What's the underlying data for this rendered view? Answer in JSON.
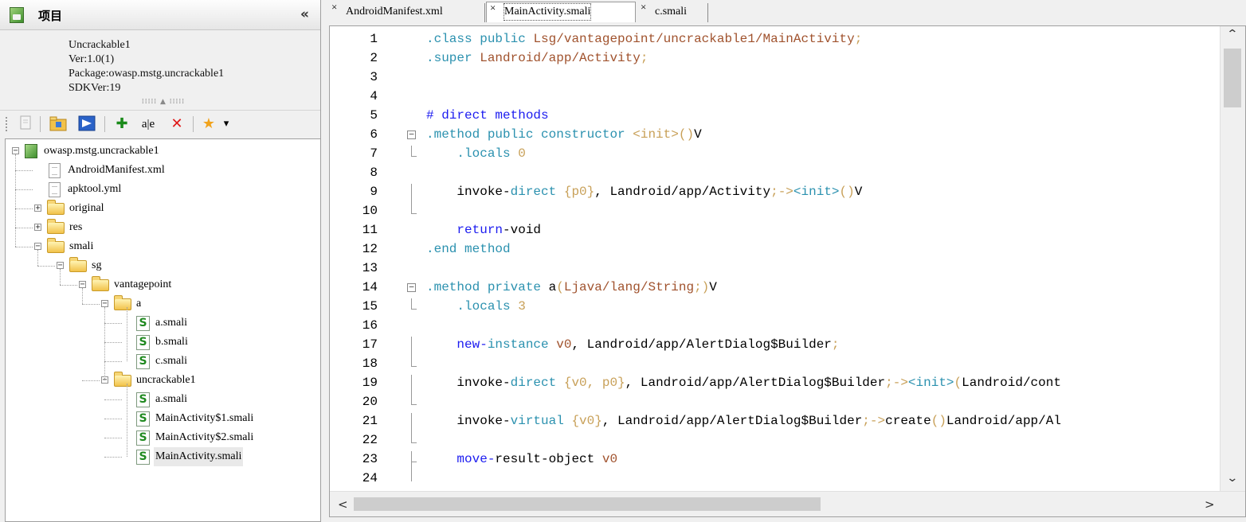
{
  "panel": {
    "title": "项目",
    "collapse_glyph": "«",
    "info": {
      "app_name": "Uncrackable1",
      "version": "Ver:1.0(1)",
      "package": "Package:owasp.mstg.uncrackable1",
      "sdk": "SDKVer:19"
    },
    "splitter_text": "⁞⁞⁞⁞⁞ ▲ ⁞⁞⁞⁞⁞",
    "toolbar": {
      "icons": [
        "file-icon",
        "folder-open-icon",
        "screen-icon",
        "add-icon",
        "rename-icon",
        "delete-icon",
        "favorite-icon",
        "dropdown-icon"
      ],
      "add_glyph": "✚",
      "rename_glyph": "a|e",
      "delete_glyph": "✕",
      "favorite_glyph": "★",
      "dropdown_glyph": "▾"
    }
  },
  "tree": {
    "expanded_glyph": "−",
    "collapsed_glyph": "+",
    "smali_glyph": "S",
    "items": [
      {
        "label": "owasp.mstg.uncrackable1",
        "type": "project",
        "expander": "−"
      },
      {
        "label": "AndroidManifest.xml",
        "type": "file"
      },
      {
        "label": "apktool.yml",
        "type": "file"
      },
      {
        "label": "original",
        "type": "folder",
        "expander": "+"
      },
      {
        "label": "res",
        "type": "folder",
        "expander": "+"
      },
      {
        "label": "smali",
        "type": "folder",
        "expander": "−"
      },
      {
        "label": "sg",
        "type": "folder",
        "expander": "−"
      },
      {
        "label": "vantagepoint",
        "type": "folder",
        "expander": "−"
      },
      {
        "label": "a",
        "type": "folder",
        "expander": "−"
      },
      {
        "label": "a.smali",
        "type": "smali"
      },
      {
        "label": "b.smali",
        "type": "smali"
      },
      {
        "label": "c.smali",
        "type": "smali"
      },
      {
        "label": "uncrackable1",
        "type": "folder",
        "expander": "−"
      },
      {
        "label": "a.smali",
        "type": "smali"
      },
      {
        "label": "MainActivity$1.smali",
        "type": "smali"
      },
      {
        "label": "MainActivity$2.smali",
        "type": "smali"
      },
      {
        "label": "MainActivity.smali",
        "type": "smali",
        "selected": true
      }
    ]
  },
  "tabs": [
    {
      "label": "AndroidManifest.xml",
      "close": "×",
      "active": false
    },
    {
      "label": "MainActivity.smali",
      "close": "×",
      "active": true
    },
    {
      "label": "c.smali",
      "close": "×",
      "active": false
    }
  ],
  "editor": {
    "colors": {
      "keyword": "#1c1cf0",
      "cyan": "#2b91af",
      "orange": "#c8a058",
      "brown": "#a0522d",
      "default": "#000000"
    },
    "fold_open": "−",
    "lines": [
      {
        "n": "1",
        "tokens": [
          {
            "t": ".class ",
            "c": "cyan"
          },
          {
            "t": "public ",
            "c": "cyan"
          },
          {
            "t": "Lsg/vantagepoint/uncrackable1/MainActivity",
            "c": "brown"
          },
          {
            "t": ";",
            "c": "orange"
          }
        ]
      },
      {
        "n": "2",
        "tokens": [
          {
            "t": ".super ",
            "c": "cyan"
          },
          {
            "t": "Landroid/app/Activity",
            "c": "brown"
          },
          {
            "t": ";",
            "c": "orange"
          }
        ]
      },
      {
        "n": "3",
        "tokens": []
      },
      {
        "n": "4",
        "tokens": []
      },
      {
        "n": "5",
        "tokens": [
          {
            "t": "# direct methods",
            "c": "keyword"
          }
        ]
      },
      {
        "n": "6",
        "tokens": [
          {
            "t": ".method ",
            "c": "cyan"
          },
          {
            "t": "public ",
            "c": "cyan"
          },
          {
            "t": "constructor ",
            "c": "cyan"
          },
          {
            "t": "<init>",
            "c": "orange"
          },
          {
            "t": "()",
            "c": "orange"
          },
          {
            "t": "V",
            "c": "default"
          }
        ]
      },
      {
        "n": "7",
        "tokens": [
          {
            "t": "    .locals ",
            "c": "cyan"
          },
          {
            "t": "0",
            "c": "orange"
          }
        ]
      },
      {
        "n": "8",
        "tokens": []
      },
      {
        "n": "9",
        "tokens": [
          {
            "t": "    invoke-",
            "c": "default"
          },
          {
            "t": "direct ",
            "c": "cyan"
          },
          {
            "t": "{p0}",
            "c": "orange"
          },
          {
            "t": ", Landroid/app/Activity",
            "c": "default"
          },
          {
            "t": ";->",
            "c": "orange"
          },
          {
            "t": "<init>",
            "c": "cyan"
          },
          {
            "t": "()",
            "c": "orange"
          },
          {
            "t": "V",
            "c": "default"
          }
        ]
      },
      {
        "n": "10",
        "tokens": []
      },
      {
        "n": "11",
        "tokens": [
          {
            "t": "    return",
            "c": "keyword"
          },
          {
            "t": "-void",
            "c": "default"
          }
        ]
      },
      {
        "n": "12",
        "tokens": [
          {
            "t": ".end ",
            "c": "cyan"
          },
          {
            "t": "method",
            "c": "cyan"
          }
        ]
      },
      {
        "n": "13",
        "tokens": []
      },
      {
        "n": "14",
        "tokens": [
          {
            "t": ".method ",
            "c": "cyan"
          },
          {
            "t": "private ",
            "c": "cyan"
          },
          {
            "t": "a",
            "c": "default"
          },
          {
            "t": "(",
            "c": "orange"
          },
          {
            "t": "Ljava/lang/String",
            "c": "brown"
          },
          {
            "t": ";)",
            "c": "orange"
          },
          {
            "t": "V",
            "c": "default"
          }
        ]
      },
      {
        "n": "15",
        "tokens": [
          {
            "t": "    .locals ",
            "c": "cyan"
          },
          {
            "t": "3",
            "c": "orange"
          }
        ]
      },
      {
        "n": "16",
        "tokens": []
      },
      {
        "n": "17",
        "tokens": [
          {
            "t": "    new-",
            "c": "keyword"
          },
          {
            "t": "instance ",
            "c": "cyan"
          },
          {
            "t": "v0",
            "c": "brown"
          },
          {
            "t": ", Landroid/app/AlertDialog$Builder",
            "c": "default"
          },
          {
            "t": ";",
            "c": "orange"
          }
        ]
      },
      {
        "n": "18",
        "tokens": []
      },
      {
        "n": "19",
        "tokens": [
          {
            "t": "    invoke-",
            "c": "default"
          },
          {
            "t": "direct ",
            "c": "cyan"
          },
          {
            "t": "{v0, p0}",
            "c": "orange"
          },
          {
            "t": ", Landroid/app/AlertDialog$Builder",
            "c": "default"
          },
          {
            "t": ";->",
            "c": "orange"
          },
          {
            "t": "<init>",
            "c": "cyan"
          },
          {
            "t": "(",
            "c": "orange"
          },
          {
            "t": "Landroid/cont",
            "c": "default"
          }
        ]
      },
      {
        "n": "20",
        "tokens": []
      },
      {
        "n": "21",
        "tokens": [
          {
            "t": "    invoke-",
            "c": "default"
          },
          {
            "t": "virtual ",
            "c": "cyan"
          },
          {
            "t": "{v0}",
            "c": "orange"
          },
          {
            "t": ", Landroid/app/AlertDialog$Builder",
            "c": "default"
          },
          {
            "t": ";->",
            "c": "orange"
          },
          {
            "t": "create",
            "c": "default"
          },
          {
            "t": "()",
            "c": "orange"
          },
          {
            "t": "Landroid/app/Al",
            "c": "default"
          }
        ]
      },
      {
        "n": "22",
        "tokens": []
      },
      {
        "n": "23",
        "tokens": [
          {
            "t": "    move-",
            "c": "keyword"
          },
          {
            "t": "result-object ",
            "c": "default"
          },
          {
            "t": "v0",
            "c": "brown"
          }
        ]
      },
      {
        "n": "24",
        "tokens": []
      }
    ]
  },
  "scrollbars": {
    "up": "⌃",
    "down": "⌄",
    "left": "<",
    "right": ">"
  }
}
